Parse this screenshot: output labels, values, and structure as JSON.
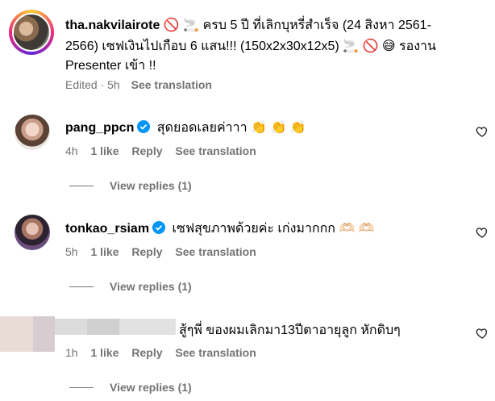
{
  "post": {
    "username": "tha.nakvilairote",
    "caption_line1": "🚫 🚬 ครบ 5 ปี ที่เลิกบุหรี่สำเร็จ (24 สิงหา 2561-",
    "caption_line2": "2566) เซฟเงินไปเกือบ 6 แสน!!! (150x2x30x12x5) 🚬 🚫 😅 รองาน",
    "caption_line3": "Presenter เข้า !!",
    "meta_time": "Edited · 5h",
    "see_translation": "See translation"
  },
  "comments": [
    {
      "username": "pang_ppcn",
      "text": "สุดยอดเลยค่าาา 👏 👏 👏",
      "time": "4h",
      "likes": "1 like",
      "reply": "Reply",
      "see_translation": "See translation",
      "view_replies": "View replies (1)"
    },
    {
      "username": "tonkao_rsiam",
      "text": "เซฟสุขภาพด้วยค่ะ เก่งมากกก 🫶🏻 🫶🏻",
      "time": "5h",
      "likes": "1 like",
      "reply": "Reply",
      "see_translation": "See translation",
      "view_replies": "View replies (1)"
    },
    {
      "username": "",
      "text": "สู้ๆพี่ ของผมเลิกมา13ปีตาอายุลูก หักดิบๆ",
      "time": "1h",
      "likes": "1 like",
      "reply": "Reply",
      "see_translation": "See translation",
      "view_replies": "View replies (1)"
    }
  ],
  "colors": {
    "secondary_text": "#737373",
    "verified_blue": "#0095f6"
  },
  "icons": [
    "heart-icon",
    "verified-badge-icon"
  ]
}
